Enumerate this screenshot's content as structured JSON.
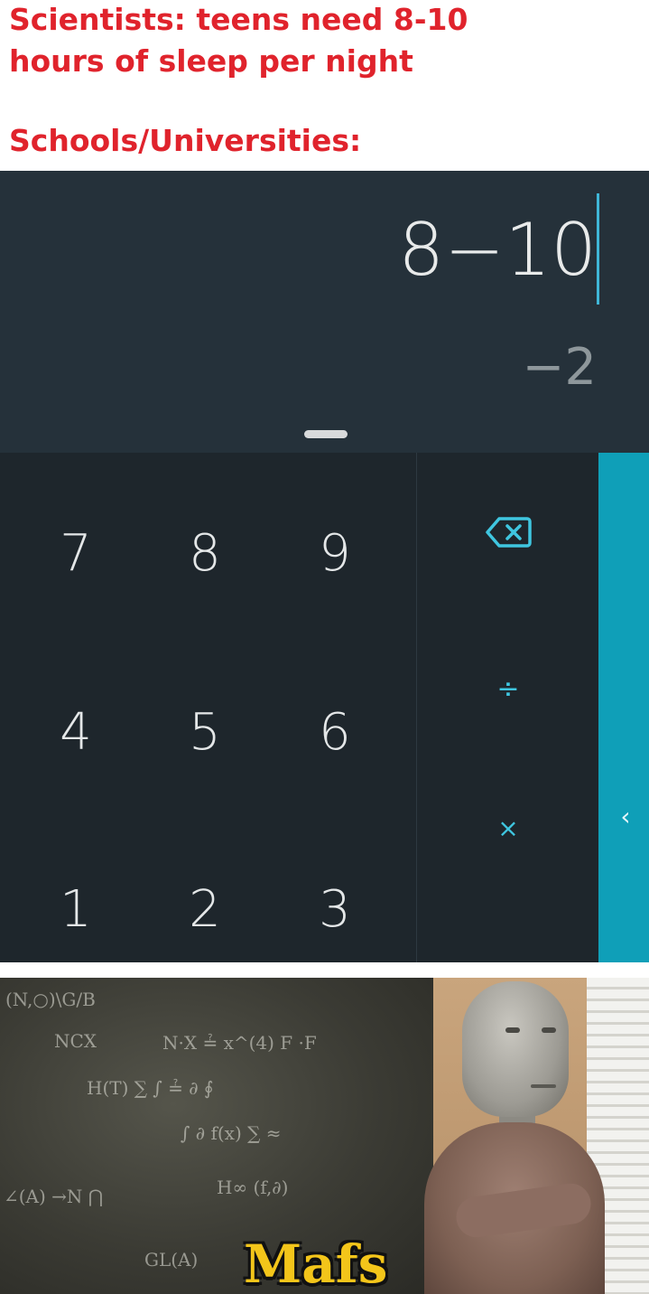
{
  "caption": {
    "line1": "Scientists: teens need 8-10",
    "line2": "hours of sleep per night",
    "line3": "Schools/Universities:",
    "color": "#e0232c"
  },
  "calculator": {
    "expression": "8−10",
    "result": "−2",
    "keys": {
      "k7": "7",
      "k8": "8",
      "k9": "9",
      "k4": "4",
      "k5": "5",
      "k6": "6",
      "k1": "1",
      "k2": "2",
      "k3": "3"
    },
    "ops": {
      "divide": "÷",
      "multiply": "×"
    },
    "icons": {
      "backspace": "backspace-icon",
      "advanced": "chevron-left-icon"
    },
    "colors": {
      "display_bg": "#25313a",
      "pad_bg": "#1e262c",
      "accent": "#3fc6e0",
      "advanced_bg": "#0f9fb8"
    }
  },
  "meme": {
    "caption": "Mafs",
    "caption_color": "#f3c51a"
  }
}
